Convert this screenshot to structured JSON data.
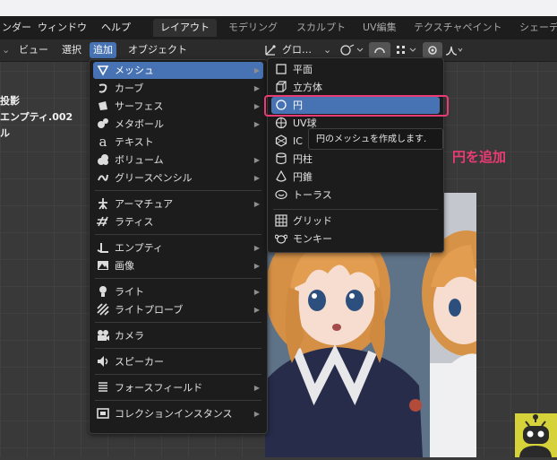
{
  "topbar": {
    "menu": [
      "ンダー",
      "ウィンドウ",
      "ヘルプ"
    ],
    "workspaces": [
      {
        "label": "レイアウト",
        "active": true
      },
      {
        "label": "モデリング",
        "active": false
      },
      {
        "label": "スカルプト",
        "active": false
      },
      {
        "label": "UV編集",
        "active": false
      },
      {
        "label": "テクスチャペイント",
        "active": false
      },
      {
        "label": "シェーデ",
        "active": false
      }
    ]
  },
  "header": {
    "menus": [
      {
        "label": "ビュー",
        "active": false
      },
      {
        "label": "選択",
        "active": false
      },
      {
        "label": "追加",
        "active": true
      },
      {
        "label": "オブジェクト",
        "active": false
      }
    ],
    "transform_label": "グロ…"
  },
  "overlay": {
    "lines": [
      "投影",
      "エンプティ.002",
      "ル"
    ]
  },
  "add_menu": {
    "items": [
      {
        "label": "メッシュ",
        "icon": "mesh-icon",
        "submenu": true,
        "selected": true
      },
      {
        "label": "カーブ",
        "icon": "curve-icon",
        "submenu": true
      },
      {
        "label": "サーフェス",
        "icon": "surface-icon",
        "submenu": true
      },
      {
        "label": "メタボール",
        "icon": "metaball-icon",
        "submenu": true
      },
      {
        "label": "テキスト",
        "icon": "text-icon",
        "submenu": false
      },
      {
        "label": "ボリューム",
        "icon": "volume-icon",
        "submenu": true
      },
      {
        "label": "グリースペンシル",
        "icon": "grease-pencil-icon",
        "submenu": true
      },
      {
        "label": "アーマチュア",
        "icon": "armature-icon",
        "submenu": true
      },
      {
        "label": "ラティス",
        "icon": "lattice-icon",
        "submenu": false
      },
      {
        "label": "エンプティ",
        "icon": "empty-icon",
        "submenu": true
      },
      {
        "label": "画像",
        "icon": "image-icon",
        "submenu": true
      },
      {
        "label": "ライト",
        "icon": "light-icon",
        "submenu": true
      },
      {
        "label": "ライトプローブ",
        "icon": "light-probe-icon",
        "submenu": true
      },
      {
        "label": "カメラ",
        "icon": "camera-icon",
        "submenu": false
      },
      {
        "label": "スピーカー",
        "icon": "speaker-icon",
        "submenu": false
      },
      {
        "label": "フォースフィールド",
        "icon": "force-field-icon",
        "submenu": true
      },
      {
        "label": "コレクションインスタンス",
        "icon": "collection-icon",
        "submenu": true
      }
    ]
  },
  "mesh_menu": {
    "items": [
      {
        "label": "平面",
        "icon": "plane-icon"
      },
      {
        "label": "立方体",
        "icon": "cube-icon"
      },
      {
        "label": "円",
        "icon": "circle-icon",
        "selected": true
      },
      {
        "label": "UV球",
        "icon": "uv-sphere-icon"
      },
      {
        "label": "IC",
        "icon": "ico-sphere-icon"
      },
      {
        "label": "円柱",
        "icon": "cylinder-icon"
      },
      {
        "label": "円錐",
        "icon": "cone-icon"
      },
      {
        "label": "トーラス",
        "icon": "torus-icon"
      },
      {
        "label": "グリッド",
        "icon": "grid-icon"
      },
      {
        "label": "モンキー",
        "icon": "monkey-icon"
      }
    ]
  },
  "tooltip": {
    "text": "円のメッシュを作成します."
  },
  "annotation": {
    "text": "円を追加",
    "color": "#ea3b74"
  },
  "colors": {
    "accent": "#4772b3",
    "highlight": "#ea3b74"
  }
}
